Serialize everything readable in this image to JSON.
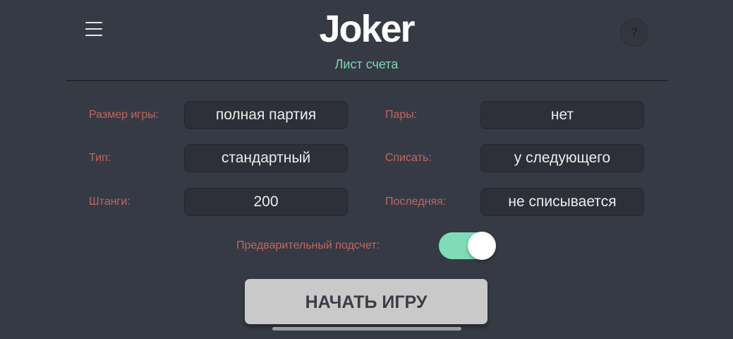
{
  "header": {
    "title": "Joker",
    "subtitle": "Лист счета",
    "help_label": "?"
  },
  "settings": {
    "game_size": {
      "label": "Размер игры:",
      "value": "полная партия"
    },
    "type": {
      "label": "Тип:",
      "value": "стандартный"
    },
    "penalty": {
      "label": "Штанги:",
      "value": "200"
    },
    "pairs": {
      "label": "Пары:",
      "value": "нет"
    },
    "write_off": {
      "label": "Списать:",
      "value": "у следующего"
    },
    "last": {
      "label": "Последняя:",
      "value": "не списывается"
    },
    "preliminary": {
      "label": "Предварительный подсчет:",
      "enabled": true
    }
  },
  "start_button": {
    "label": "НАЧАТЬ ИГРУ"
  },
  "colors": {
    "background": "#363a45",
    "label": "#c0675e",
    "accent": "#7bd8b5",
    "toggle_on": "#7fdcb7",
    "field_bg": "#2d3039",
    "button_bg": "#c9c9c9"
  },
  "icons": {
    "menu": "hamburger-icon",
    "help": "question-icon"
  }
}
